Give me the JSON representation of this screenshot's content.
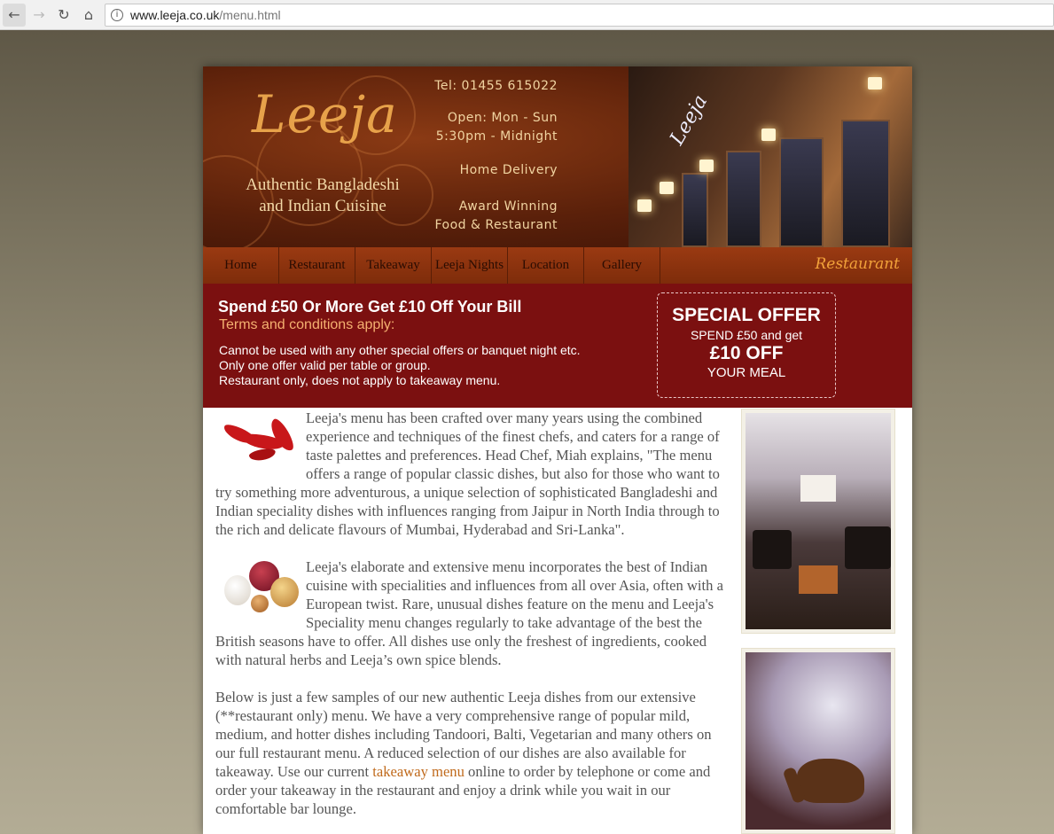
{
  "browser": {
    "url_host": "www.leeja.co.uk",
    "url_path": "/menu.html"
  },
  "header": {
    "logo": "Leeja",
    "tagline_1": "Authentic Bangladeshi",
    "tagline_2": "and Indian Cuisine",
    "tel": "Tel: 01455 615022",
    "open_1": "Open: Mon - Sun",
    "open_2": "5:30pm - Midnight",
    "delivery": "Home Delivery",
    "award_1": "Award Winning",
    "award_2": "Food & Restaurant"
  },
  "nav": {
    "items": [
      {
        "label": "Home"
      },
      {
        "label": "Restaurant"
      },
      {
        "label": "Takeaway"
      },
      {
        "label": "Leeja Nights"
      },
      {
        "label": "Location"
      },
      {
        "label": "Gallery"
      }
    ],
    "section_label": "Restaurant"
  },
  "offer": {
    "headline": "Spend £50 Or More Get £10 Off Your Bill",
    "terms": "Terms and conditions apply:",
    "conditions": [
      "Cannot be used with any other special offers or banquet night etc.",
      "Only one offer valid per table or group.",
      "Restaurant only, does not apply to takeaway menu."
    ],
    "box": {
      "title": "SPECIAL OFFER",
      "line2": "SPEND £50 and get",
      "line3": "£10 OFF",
      "line4": "YOUR MEAL"
    }
  },
  "content": {
    "p1": "Leeja's menu has been crafted over many years using the combined experience and techniques of the finest chefs, and caters for a range of taste palettes and preferences. Head Chef, Miah explains, \"The menu offers a range of popular classic dishes, but also for those who want to try something more adventurous, a unique selection of sophisticated Bangladeshi and Indian speciality dishes with influences ranging from Jaipur in North India through to the rich and delicate flavours of Mumbai, Hyderabad and Sri-Lanka\".",
    "p2": "Leeja's elaborate and extensive menu incorporates the best of Indian cuisine with specialities and influences from all over Asia, often with a European twist. Rare, unusual dishes feature on the menu and Leeja's Speciality menu changes regularly to take advantage of the best the British seasons have to offer. All dishes use only the freshest of ingredients, cooked with natural herbs and Leeja’s own spice blends.",
    "p3_before": "Below is just a few samples of our new authentic Leeja dishes from our extensive (**restaurant only) menu. We have a very comprehensive range of popular mild, medium, and hotter dishes including Tandoori, Balti, Vegetarian and many others on our full restaurant menu. A reduced selection of our dishes are also available for takeaway. Use our current ",
    "p3_link": "takeaway menu",
    "p3_after": " online to order by telephone or come and order your takeaway in the restaurant and enjoy a drink while you wait in our comfortable bar lounge."
  },
  "colors": {
    "header_brown": "#5a200a",
    "nav_orange": "#8a3210",
    "offer_red": "#7b1010",
    "logo_gold": "#e7a24a",
    "link": "#c06a1c"
  }
}
